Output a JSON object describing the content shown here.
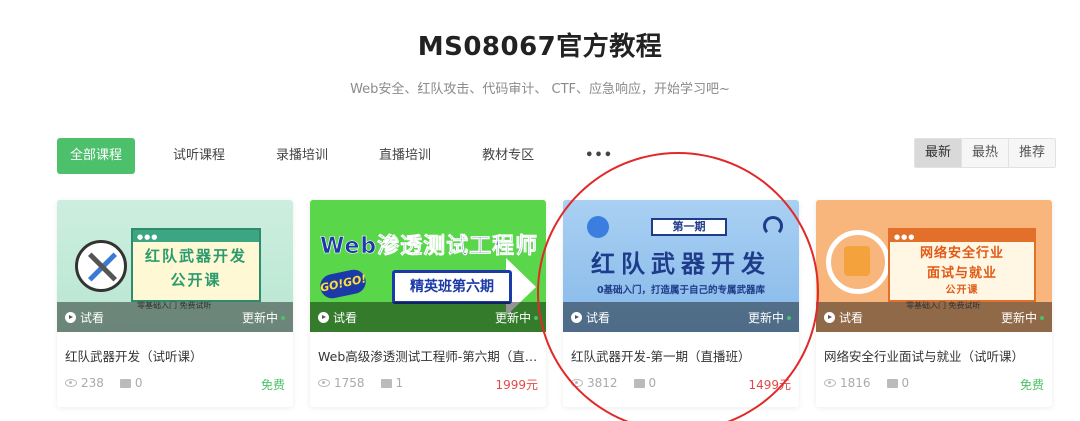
{
  "header": {
    "title": "MS08067官方教程",
    "subtitle": "Web安全、红队攻击、代码审计、 CTF、应急响应，开始学习吧~"
  },
  "tabs": [
    {
      "label": "全部课程",
      "active": true
    },
    {
      "label": "试听课程",
      "active": false
    },
    {
      "label": "录播培训",
      "active": false
    },
    {
      "label": "直播培训",
      "active": false
    },
    {
      "label": "教材专区",
      "active": false
    },
    {
      "label": "•••",
      "active": false
    }
  ],
  "sorts": [
    {
      "label": "最新",
      "active": true
    },
    {
      "label": "最热",
      "active": false
    },
    {
      "label": "推荐",
      "active": false
    }
  ],
  "courses": [
    {
      "title": "红队武器开发（试听课）",
      "views": "238",
      "comments": "0",
      "price": "免费",
      "price_color": "#4cc06a",
      "overlay_left": "试看",
      "overlay_right": "更新中",
      "thumb": {
        "line1": "红队武器开发",
        "line2": "公开课",
        "foot": "零基础入门  免费试听"
      }
    },
    {
      "title": "Web高级渗透测试工程师-第六期（直…",
      "views": "1758",
      "comments": "1",
      "price": "1999元",
      "price_color": "#e24a4a",
      "overlay_left": "试看",
      "overlay_right": "更新中",
      "thumb": {
        "line1": "Web渗透测试工程师",
        "line2": "精英班第六期",
        "badge": "GO!GO!"
      }
    },
    {
      "title": "红队武器开发-第一期（直播班）",
      "views": "3812",
      "comments": "0",
      "price": "1499元",
      "price_color": "#e24a4a",
      "overlay_left": "试看",
      "overlay_right": "更新中",
      "thumb": {
        "tag": "第一期",
        "line1": "红队武器开发",
        "line2": "0基础入门，打造属于自己的专属武器库"
      }
    },
    {
      "title": "网络安全行业面试与就业（试听课）",
      "views": "1816",
      "comments": "0",
      "price": "免费",
      "price_color": "#4cc06a",
      "overlay_left": "试看",
      "overlay_right": "更新中",
      "thumb": {
        "line1": "网络安全行业",
        "line2": "面试与就业",
        "line3": "公开课",
        "foot": "零基础入门  免费试听"
      }
    }
  ]
}
